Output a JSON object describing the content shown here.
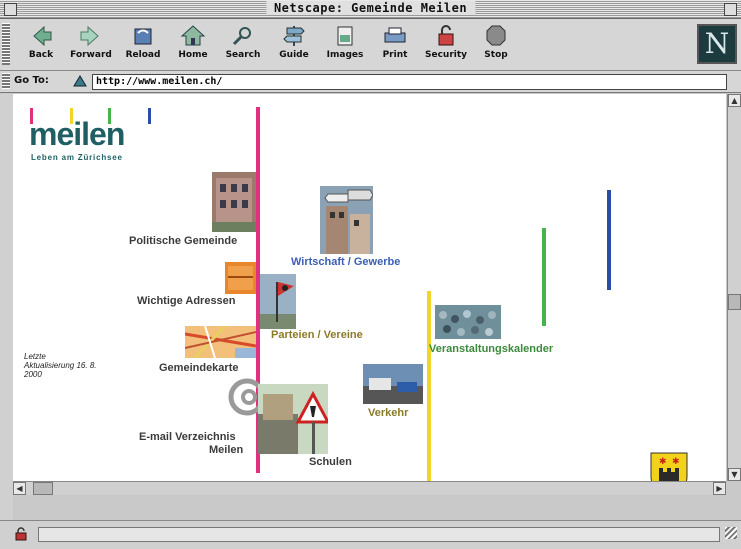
{
  "window": {
    "title": "Netscape: Gemeinde Meilen"
  },
  "toolbar": {
    "buttons": [
      {
        "label": "Back",
        "icon": "back-arrow-icon"
      },
      {
        "label": "Forward",
        "icon": "forward-arrow-icon"
      },
      {
        "label": "Reload",
        "icon": "reload-icon"
      },
      {
        "label": "Home",
        "icon": "home-icon"
      },
      {
        "label": "Search",
        "icon": "search-icon"
      },
      {
        "label": "Guide",
        "icon": "guide-icon"
      },
      {
        "label": "Images",
        "icon": "images-icon"
      },
      {
        "label": "Print",
        "icon": "print-icon"
      },
      {
        "label": "Security",
        "icon": "security-lock-icon"
      },
      {
        "label": "Stop",
        "icon": "stop-icon"
      }
    ],
    "logo_letter": "N"
  },
  "location": {
    "label": "Go To:",
    "url": "http://www.meilen.ch/"
  },
  "page": {
    "logo": "meilen",
    "tagline": "Leben am Zürichsee",
    "update_note": [
      "Letzte",
      "Aktualisierung 16. 8.",
      "2000"
    ],
    "links": {
      "politische": "Politische Gemeinde",
      "adressen": "Wichtige Adressen",
      "karte": "Gemeindekarte",
      "email1": "E-mail Verzeichnis",
      "email2": "Meilen",
      "wirtschaft": "Wirtschaft / Gewerbe",
      "parteien": "Parteien / Vereine",
      "schulen": "Schulen",
      "verkehr": "Verkehr",
      "kalender": "Veranstaltungskalender"
    },
    "colors": {
      "pink": "#e0307f",
      "yellow": "#f1d52a",
      "green": "#45b44a",
      "blue": "#2a4ea6",
      "link_blue": "#3a5fb5",
      "link_green": "#3c8a3c",
      "link_olive": "#8a7a28",
      "logo_teal": "#1f5f64"
    }
  }
}
